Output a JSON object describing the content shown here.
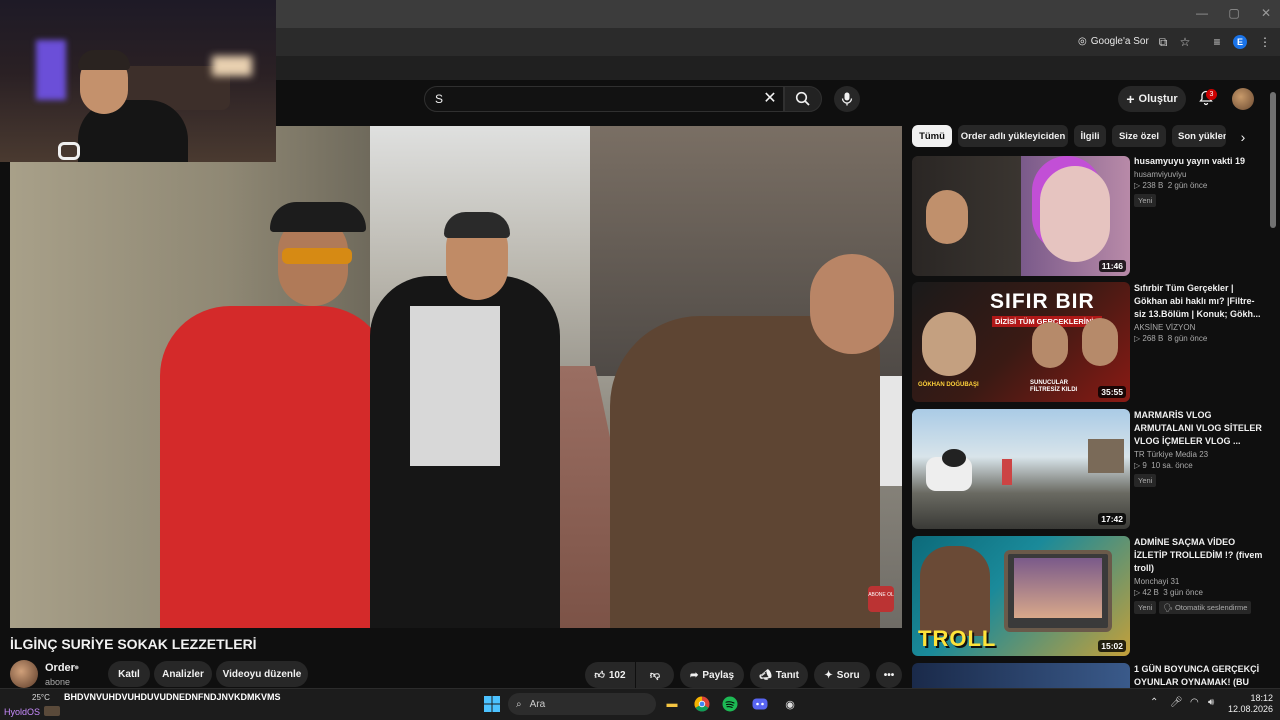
{
  "browser": {
    "ask_google": "Google'a Sor",
    "profile_initial": "E"
  },
  "masthead": {
    "search_value": "S",
    "create_label": "Oluştur",
    "notification_count": "3"
  },
  "filter_chips": [
    "Tümü",
    "Order adlı yükleyiciden",
    "İlgili",
    "Size özel",
    "Son yüklen"
  ],
  "video": {
    "title": "İLGİNÇ SURİYE SOKAK LEZZETLERİ",
    "channel": "Order",
    "subscribers": "abone",
    "watermark": "ABONE OL"
  },
  "actions": {
    "join": "Katıl",
    "analytics": "Analizler",
    "edit": "Videoyu düzenle",
    "likes": "102",
    "share": "Paylaş",
    "promote": "Tanıt",
    "ask": "Soru"
  },
  "recommendations": [
    {
      "title": "husamyuyu yayın vakti 19",
      "channel": "husamviyuviyu",
      "views": "238 B",
      "age": "2 gün önce",
      "badges": [
        "Yeni"
      ],
      "duration": "11:46"
    },
    {
      "title": "Sıfırbir Tüm Gerçekler | Gökhan abi haklı mı? |Filtre-siz 13.Bölüm | Konuk; Gökh...",
      "channel": "AKSİNE VİZYON",
      "views": "268 B",
      "age": "8 gün önce",
      "badges": [],
      "duration": "35:55"
    },
    {
      "title": "MARMARİS VLOG ARMUTALANI VLOG SİTELER VLOG İÇMELER VLOG ...",
      "channel": "TR Türkiye Media 23",
      "views": "9",
      "age": "10 sa. önce",
      "badges": [
        "Yeni"
      ],
      "duration": "17:42"
    },
    {
      "title": "ADMİNE SAÇMA VİDEO İZLETİP TROLLEDİM !? (fivem troll)",
      "channel": "Monchayi 31",
      "views": "42 B",
      "age": "3 gün önce",
      "badges": [
        "Yeni",
        "Otomatik seslendirme"
      ],
      "duration": "15:02"
    },
    {
      "title": "1 GÜN BOYUNCA GERÇEKÇİ OYUNLAR OYNAMAK! (BU",
      "channel": "",
      "views": "",
      "age": "",
      "badges": [],
      "duration": ""
    }
  ],
  "thumb_text": {
    "sifirbir_line1": "SIFIR BIR",
    "sifirbir_line2": "DİZİSİ TÜM GERÇEKLERİNİ",
    "sifirbir_left": "GÖKHAN DOĞUBAŞI",
    "sifirbir_right": "SUNUCULAR FİLTRESİZ KILDI",
    "troll": "TROLL"
  },
  "taskbar": {
    "ticker": "BHDVNVUHDVUHDUVUDNEDNFNDJNVKDMKVMS",
    "weather": "25°C",
    "chat_name": "HyoldOS",
    "search_label": "Ara",
    "time": "18:12",
    "date": "12.08.2026"
  },
  "colors": {
    "accent_red": "#cc0000",
    "background": "#0f0f0f",
    "chip_bg": "#272727"
  }
}
